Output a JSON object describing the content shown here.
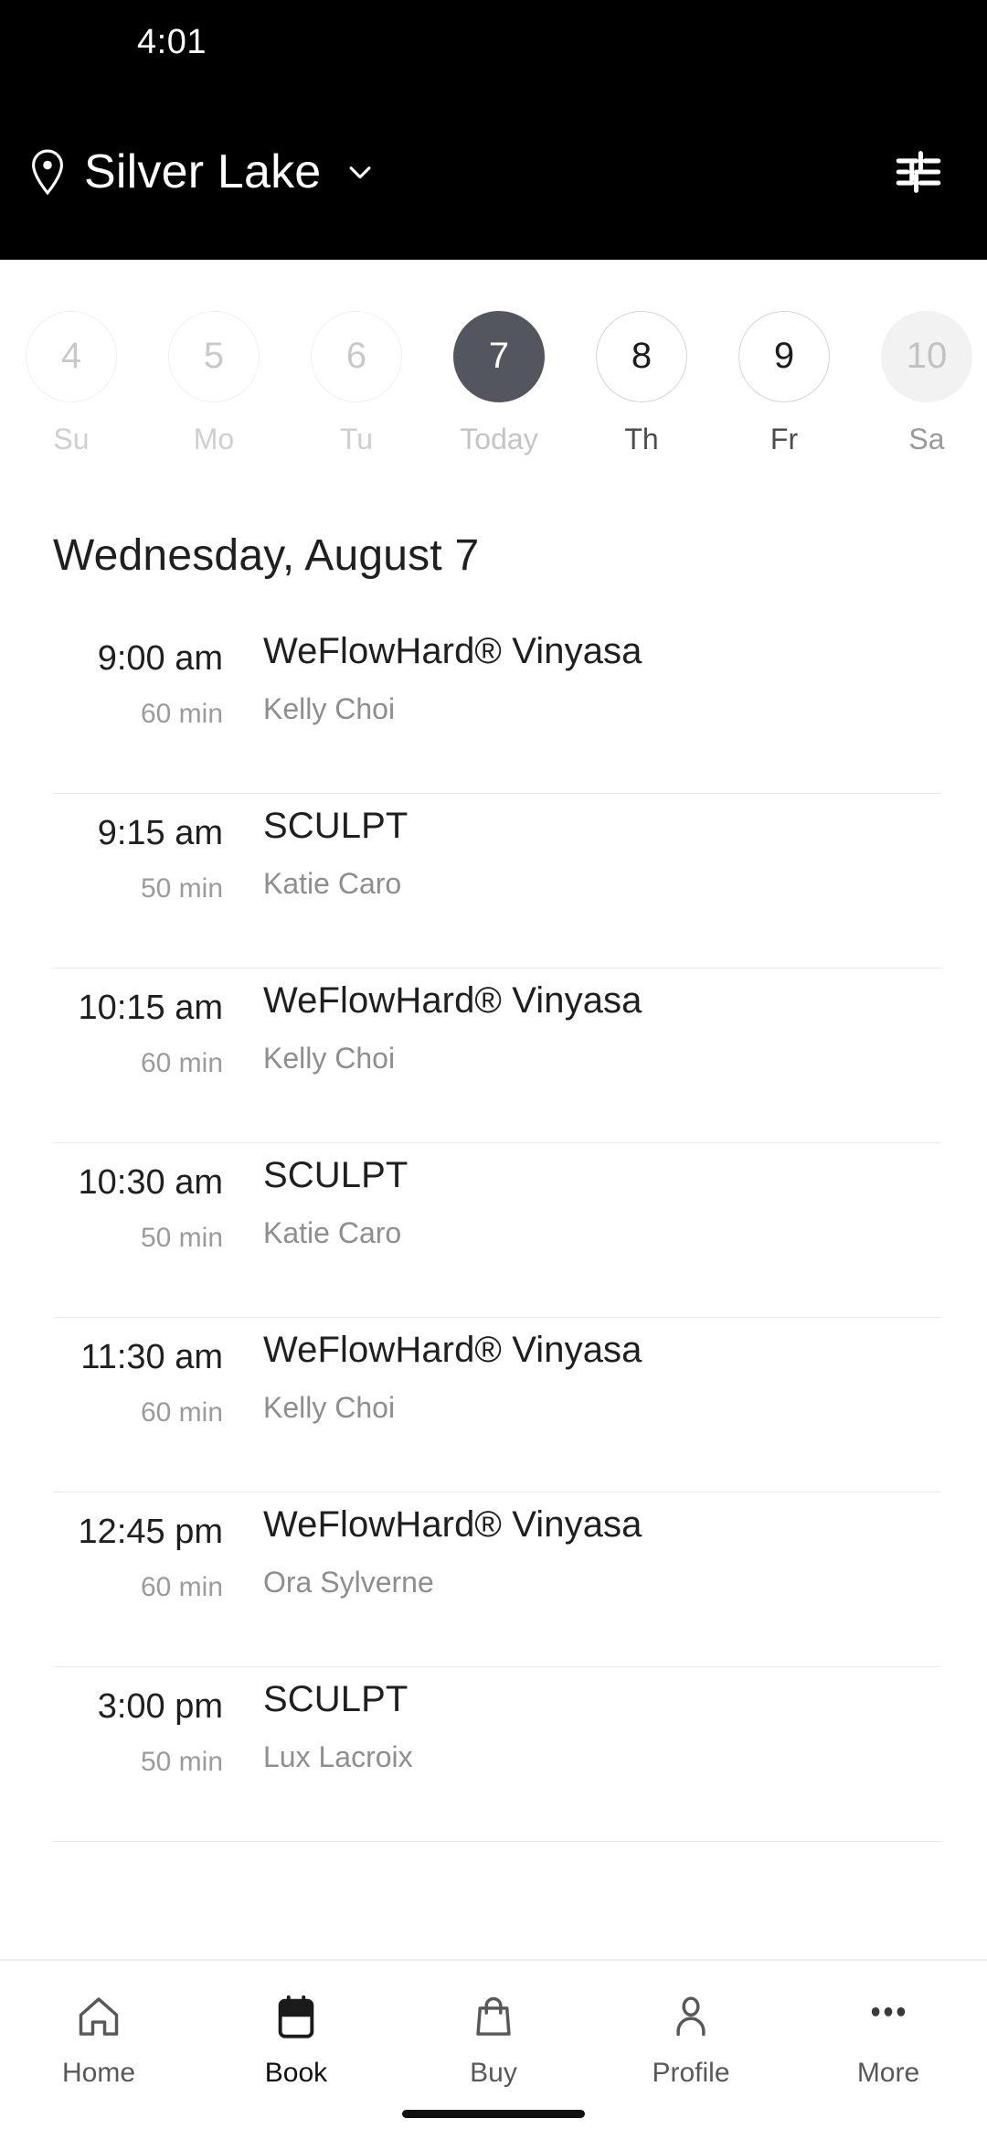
{
  "status_bar": {
    "time": "4:01"
  },
  "header": {
    "pin_icon": "location-pin-icon",
    "location": "Silver Lake",
    "chevron_icon": "chevron-down-icon",
    "filter_icon": "filter-sliders-icon",
    "background_color": "#000000",
    "text_color": "#ffffff"
  },
  "date_strip": {
    "selected_color": "#53565f",
    "days": [
      {
        "day_number": "4",
        "dow": "Su",
        "state": "disabled"
      },
      {
        "day_number": "5",
        "dow": "Mo",
        "state": "disabled"
      },
      {
        "day_number": "6",
        "dow": "Tu",
        "state": "disabled"
      },
      {
        "day_number": "7",
        "dow": "Today",
        "state": "selected"
      },
      {
        "day_number": "8",
        "dow": "Th",
        "state": "active"
      },
      {
        "day_number": "9",
        "dow": "Fr",
        "state": "active"
      },
      {
        "day_number": "10",
        "dow": "Sa",
        "state": "filled"
      }
    ]
  },
  "schedule": {
    "day_heading": "Wednesday, August 7",
    "classes": [
      {
        "time": "9:00 am",
        "duration": "60 min",
        "name": "WeFlowHard® Vinyasa",
        "instructor": "Kelly Choi"
      },
      {
        "time": "9:15 am",
        "duration": "50 min",
        "name": "SCULPT",
        "instructor": "Katie Caro"
      },
      {
        "time": "10:15 am",
        "duration": "60 min",
        "name": "WeFlowHard® Vinyasa",
        "instructor": "Kelly Choi"
      },
      {
        "time": "10:30 am",
        "duration": "50 min",
        "name": "SCULPT",
        "instructor": "Katie Caro"
      },
      {
        "time": "11:30 am",
        "duration": "60 min",
        "name": "WeFlowHard® Vinyasa",
        "instructor": "Kelly Choi"
      },
      {
        "time": "12:45 pm",
        "duration": "60 min",
        "name": "WeFlowHard® Vinyasa",
        "instructor": "Ora Sylverne"
      },
      {
        "time": "3:00 pm",
        "duration": "50 min",
        "name": "SCULPT",
        "instructor": "Lux Lacroix"
      }
    ]
  },
  "bottom_nav": {
    "selected": "Book",
    "items": [
      {
        "label": "Home",
        "icon": "home-icon"
      },
      {
        "label": "Book",
        "icon": "calendar-icon"
      },
      {
        "label": "Buy",
        "icon": "shopping-bag-icon"
      },
      {
        "label": "Profile",
        "icon": "person-icon"
      },
      {
        "label": "More",
        "icon": "ellipsis-icon"
      }
    ]
  }
}
